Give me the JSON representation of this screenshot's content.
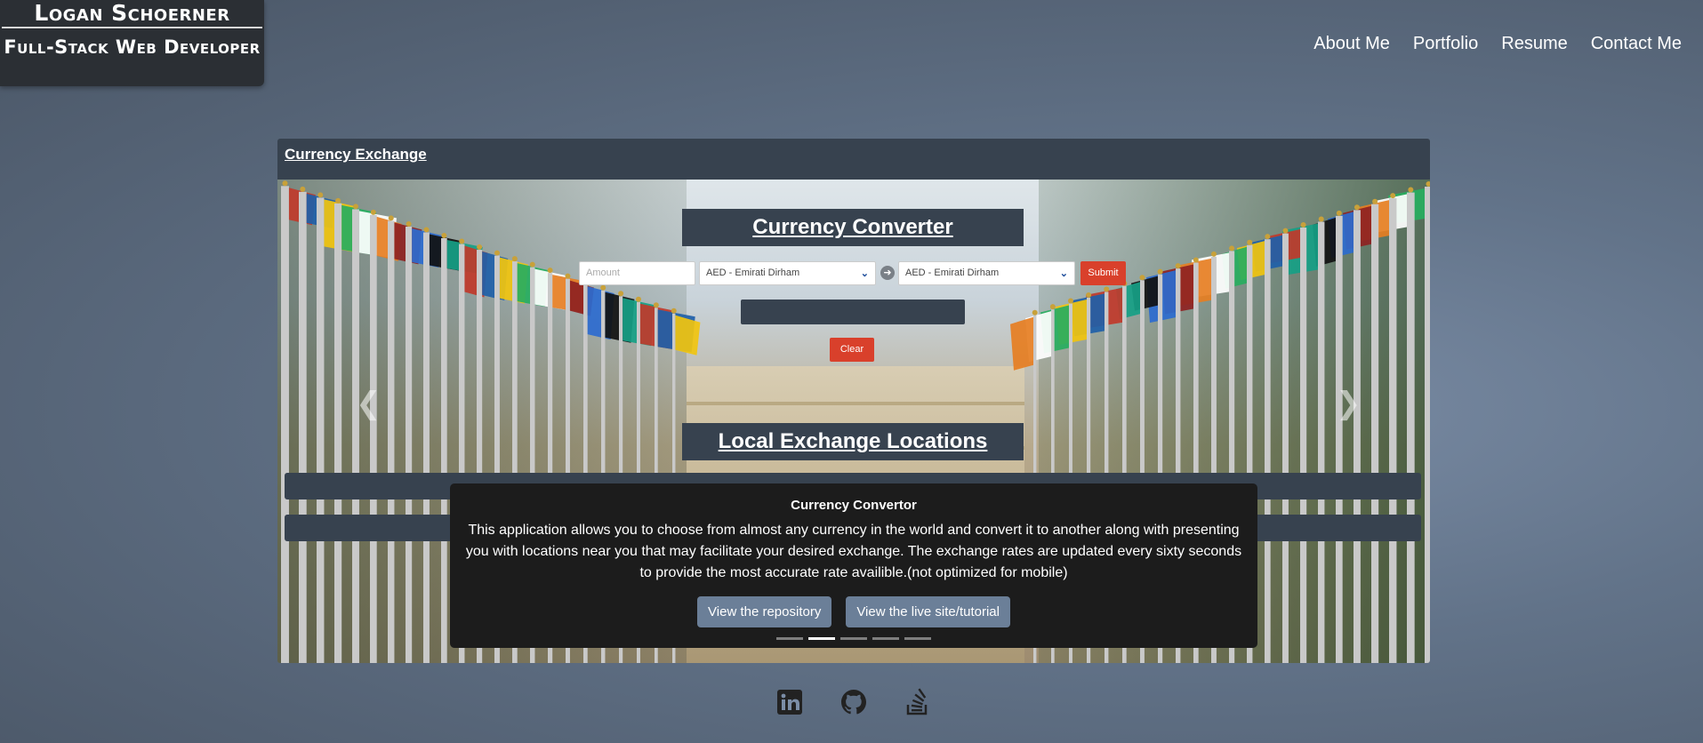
{
  "logo": {
    "name": "Logan Schoerner",
    "role": "Full-Stack Web Developer"
  },
  "nav": {
    "items": [
      "About Me",
      "Portfolio",
      "Resume",
      "Contact Me"
    ]
  },
  "card": {
    "header": "Currency Exchange"
  },
  "converter": {
    "title": "Currency Converter",
    "amount_placeholder": "Amount",
    "from_currency": "AED - Emirati Dirham",
    "to_currency": "AED - Emirati Dirham",
    "submit_label": "Submit",
    "clear_label": "Clear",
    "locations_title": "Local Exchange Locations"
  },
  "caption": {
    "title": "Currency Convertor",
    "text": "This application allows you to choose from almost any currency in the world and convert it to another along with presenting you with locations near you that may facilitate your desired exchange. The exchange rates are updated every sixty seconds to provide the most accurate rate availible.(not optimized for mobile)",
    "repo_label": "View the repository",
    "live_label": "View the live site/tutorial"
  },
  "carousel": {
    "slide_count": 5,
    "active_index": 1
  },
  "social": [
    "linkedin-icon",
    "github-icon",
    "stackoverflow-icon"
  ],
  "colors": {
    "panel": "#37424f",
    "button_red": "#d9402b",
    "caption_bg": "#1c1c1c",
    "caption_button": "#6b7f98"
  }
}
